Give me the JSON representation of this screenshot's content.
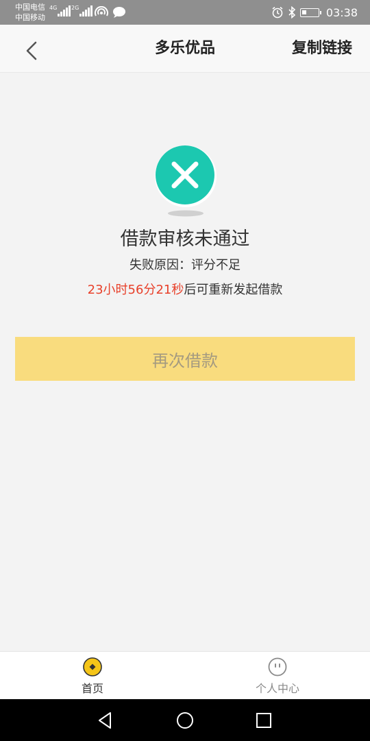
{
  "status_bar": {
    "carrier_1": "中国电信",
    "carrier_2": "中国移动",
    "net_1": "4G",
    "net_2": "2G",
    "time": "03:38"
  },
  "nav": {
    "title": "多乐优品",
    "copy_link": "复制链接"
  },
  "result": {
    "title": "借款审核未通过",
    "reason": "失败原因：评分不足",
    "countdown": "23小时56分21秒",
    "countdown_suffix": "后可重新发起借款"
  },
  "retry_button": "再次借款",
  "tabs": [
    {
      "label": "首页",
      "icon": "home-coin-icon"
    },
    {
      "label": "个人中心",
      "icon": "profile-face-icon"
    }
  ],
  "colors": {
    "accent": "#1cc8b0",
    "button": "#f9dc7e",
    "countdown": "#e8402a",
    "tab_active_icon": "#f5c518"
  }
}
